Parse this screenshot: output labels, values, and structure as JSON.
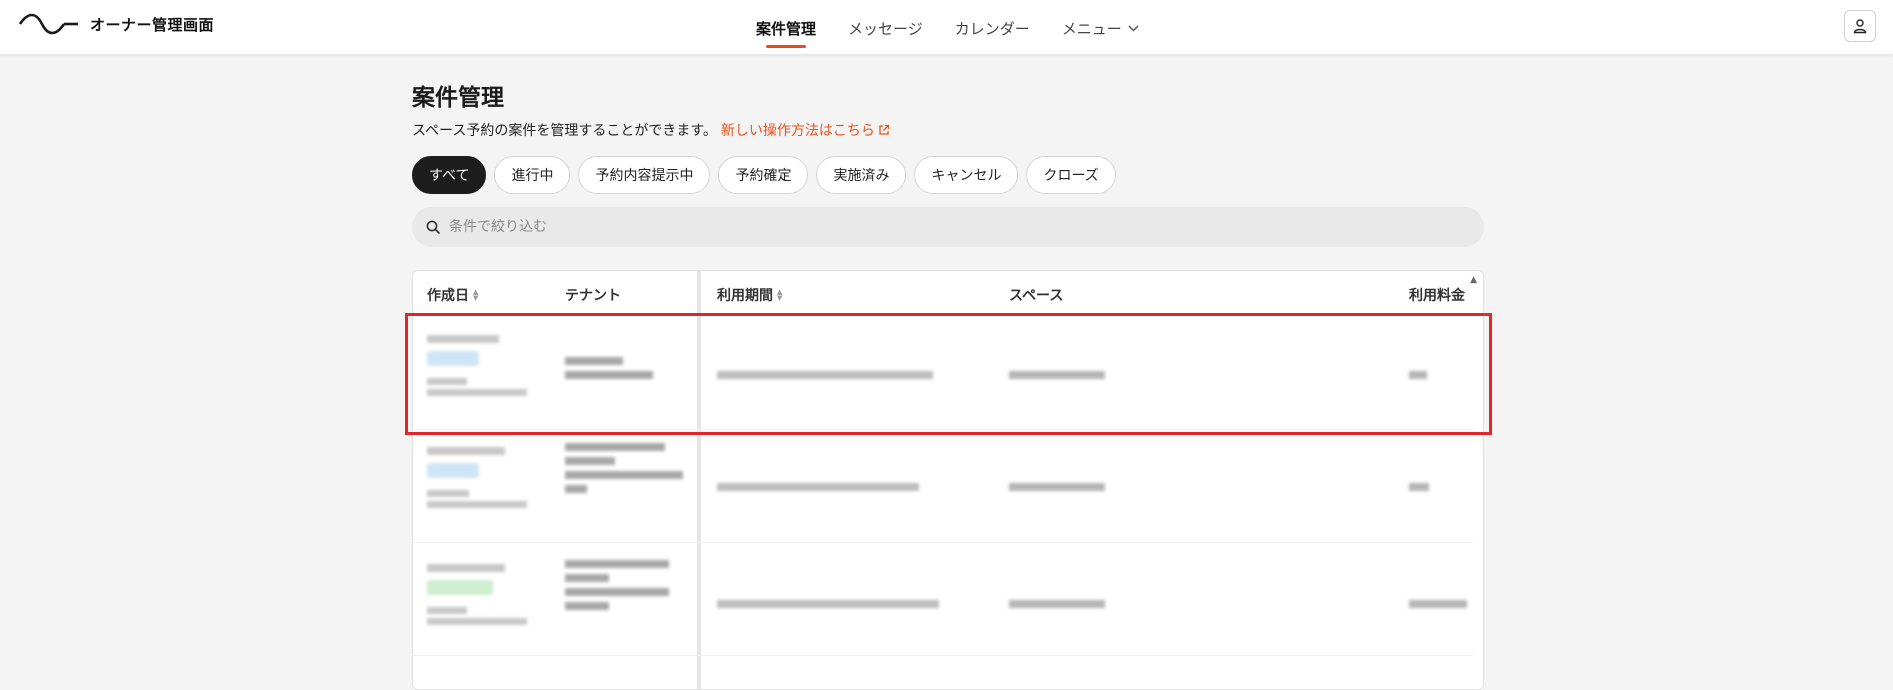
{
  "app": {
    "title": "オーナー管理画面"
  },
  "nav": {
    "items": [
      {
        "label": "案件管理",
        "active": true
      },
      {
        "label": "メッセージ",
        "active": false
      },
      {
        "label": "カレンダー",
        "active": false
      },
      {
        "label": "メニュー",
        "active": false
      }
    ]
  },
  "page": {
    "title": "案件管理",
    "description": "スペース予約の案件を管理することができます。",
    "help_link": "新しい操作方法はこちら"
  },
  "filters": [
    {
      "label": "すべて",
      "active": true
    },
    {
      "label": "進行中",
      "active": false
    },
    {
      "label": "予約内容提示中",
      "active": false
    },
    {
      "label": "予約確定",
      "active": false
    },
    {
      "label": "実施済み",
      "active": false
    },
    {
      "label": "キャンセル",
      "active": false
    },
    {
      "label": "クローズ",
      "active": false
    }
  ],
  "search": {
    "placeholder": "条件で絞り込む"
  },
  "table": {
    "columns": {
      "created": "作成日",
      "tenant": "テナント",
      "period": "利用期間",
      "space": "スペース",
      "fee": "利用料金"
    }
  },
  "colors": {
    "accent": "#ea4b1c",
    "highlight": "#e3262b"
  }
}
